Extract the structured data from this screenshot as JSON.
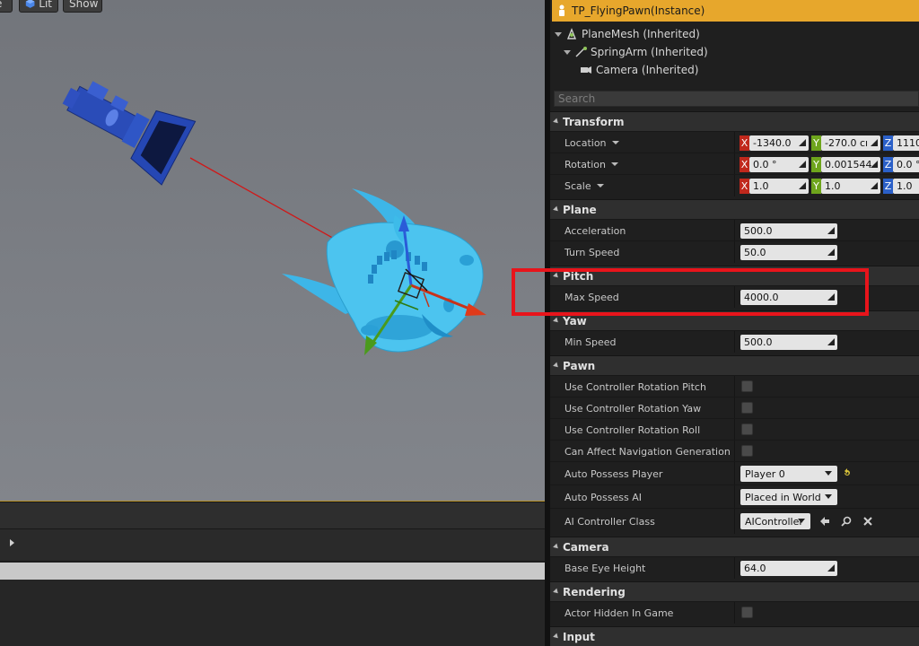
{
  "viewport": {
    "buttons": {
      "partial": "e",
      "lit": "Lit",
      "show": "Show"
    }
  },
  "details": {
    "actor_title": "TP_FlyingPawn(Instance)",
    "components": [
      {
        "label": "PlaneMesh (Inherited)"
      },
      {
        "label": "SpringArm (Inherited)"
      },
      {
        "label": "Camera (Inherited)"
      }
    ],
    "search_placeholder": "Search",
    "transform": {
      "header": "Transform",
      "location": {
        "label": "Location",
        "x": "-1340.0",
        "y": "-270.0 cı",
        "z": "1110"
      },
      "rotation": {
        "label": "Rotation",
        "x": "0.0 °",
        "y": "0.001544",
        "z": "0.0 °"
      },
      "scale": {
        "label": "Scale",
        "x": "1.0",
        "y": "1.0",
        "z": "1.0"
      },
      "axis": {
        "x": "X",
        "y": "Y",
        "z": "Z"
      }
    },
    "plane": {
      "header": "Plane",
      "acceleration": {
        "label": "Acceleration",
        "value": "500.0"
      },
      "turn_speed": {
        "label": "Turn Speed",
        "value": "50.0"
      }
    },
    "pitch": {
      "header": "Pitch",
      "max_speed": {
        "label": "Max Speed",
        "value": "4000.0"
      }
    },
    "yaw": {
      "header": "Yaw",
      "min_speed": {
        "label": "Min Speed",
        "value": "500.0"
      }
    },
    "pawn": {
      "header": "Pawn",
      "use_pitch": "Use Controller Rotation Pitch",
      "use_yaw": "Use Controller Rotation Yaw",
      "use_roll": "Use Controller Rotation Roll",
      "affect_nav": "Can Affect Navigation Generation",
      "auto_possess_player": {
        "label": "Auto Possess Player",
        "value": "Player 0"
      },
      "auto_possess_ai": {
        "label": "Auto Possess AI",
        "value": "Placed in World"
      },
      "ai_controller_class": {
        "label": "AI Controller Class",
        "value": "AIController"
      }
    },
    "camera": {
      "header": "Camera",
      "base_eye_height": {
        "label": "Base Eye Height",
        "value": "64.0"
      }
    },
    "rendering": {
      "header": "Rendering",
      "actor_hidden": "Actor Hidden In Game"
    },
    "input": {
      "header": "Input"
    }
  },
  "colors": {
    "selection_header": "#e7a72c",
    "highlight": "#e8141b",
    "axis_x": "#c0281c",
    "axis_y": "#6ea51c",
    "axis_z": "#2b60c8"
  }
}
